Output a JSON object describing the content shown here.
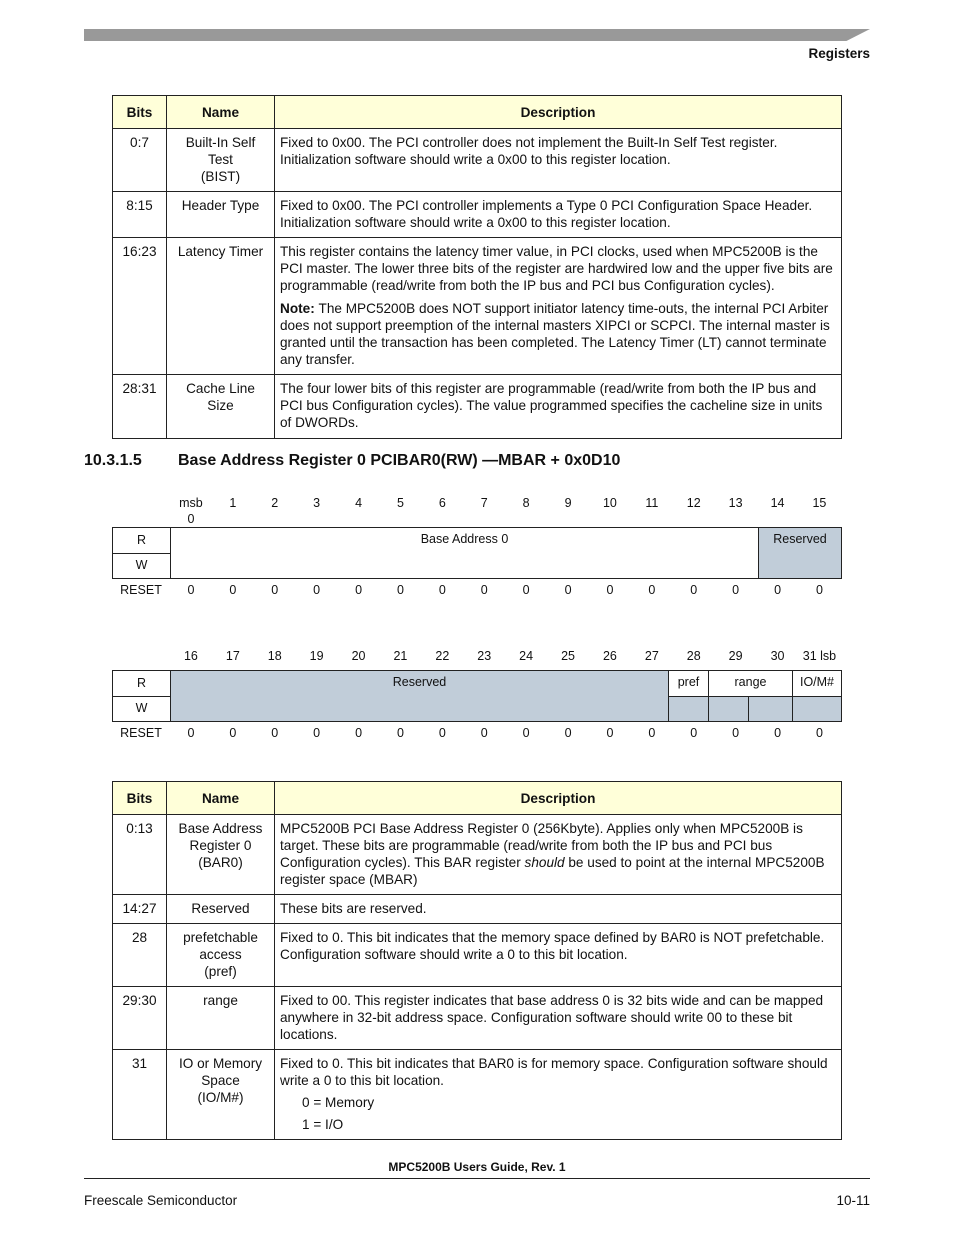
{
  "header": {
    "running_head": "Registers"
  },
  "table1": {
    "headers": [
      "Bits",
      "Name",
      "Description"
    ],
    "rows": [
      {
        "bits": "0:7",
        "name": [
          "Built-In Self",
          "Test",
          "(BIST)"
        ],
        "desc": "Fixed to 0x00. The PCI controller does not implement the Built-In Self Test register. Initialization software should write a 0x00 to this register location."
      },
      {
        "bits": "8:15",
        "name": [
          "Header Type"
        ],
        "desc": "Fixed to 0x00. The PCI controller implements a Type 0 PCI Configuration Space Header. Initialization software should write a 0x00 to this register location."
      },
      {
        "bits": "16:23",
        "name": [
          "Latency Timer"
        ],
        "desc": "This register contains the latency timer value, in PCI clocks, used when MPC5200B is the PCI master. The lower three bits of the register are hardwired low and the upper five bits are programmable (read/write from both the IP bus and PCI bus Configuration cycles).",
        "note_label": "Note:",
        "note": "The MPC5200B does NOT support initiator latency time-outs, the internal PCI Arbiter does not support preemption of the internal masters XIPCI or SCPCI. The internal master is granted until the transaction has been completed. The Latency Timer (LT) cannot terminate any transfer."
      },
      {
        "bits": "28:31",
        "name": [
          "Cache Line",
          "Size"
        ],
        "desc": "The four lower bits of this register are programmable (read/write from both the IP bus and PCI bus Configuration cycles). The value programmed specifies the cacheline size in units of DWORDs."
      }
    ]
  },
  "section": {
    "number": "10.3.1.5",
    "title": "Base Address Register 0 PCIBAR0(RW) —MBAR + 0x0D10"
  },
  "register_upper": {
    "bit_labels": [
      "msb\n0",
      "1",
      "2",
      "3",
      "4",
      "5",
      "6",
      "7",
      "8",
      "9",
      "10",
      "11",
      "12",
      "13",
      "14",
      "15"
    ],
    "r_label": "R",
    "w_label": "W",
    "reset_label": "RESET",
    "fields": [
      {
        "label": "Base Address 0"
      },
      {
        "label": "Reserved"
      }
    ],
    "reset": [
      "0",
      "0",
      "0",
      "0",
      "0",
      "0",
      "0",
      "0",
      "0",
      "0",
      "0",
      "0",
      "0",
      "0",
      "0",
      "0"
    ]
  },
  "register_lower": {
    "bit_labels": [
      "16",
      "17",
      "18",
      "19",
      "20",
      "21",
      "22",
      "23",
      "24",
      "25",
      "26",
      "27",
      "28",
      "29",
      "30",
      "31 lsb"
    ],
    "r_label": "R",
    "w_label": "W",
    "reset_label": "RESET",
    "fields": [
      {
        "label": "Reserved"
      },
      {
        "label": "pref"
      },
      {
        "label": "range"
      },
      {
        "label": "IO/M#"
      }
    ],
    "reset": [
      "0",
      "0",
      "0",
      "0",
      "0",
      "0",
      "0",
      "0",
      "0",
      "0",
      "0",
      "0",
      "0",
      "0",
      "0",
      "0"
    ]
  },
  "table2": {
    "headers": [
      "Bits",
      "Name",
      "Description"
    ],
    "rows": [
      {
        "bits": "0:13",
        "name": [
          "Base Address",
          "Register 0",
          "(BAR0)"
        ],
        "desc_pre": "MPC5200B PCI Base Address Register 0 (256Kbyte). Applies only when MPC5200B is target. These bits are programmable (read/write from both the IP bus and PCI bus Configuration cycles). This BAR register ",
        "desc_em": "should",
        "desc_post": " be used to point at the internal MPC5200B register space (MBAR)"
      },
      {
        "bits": "14:27",
        "name": [
          "Reserved"
        ],
        "desc": "These bits are reserved."
      },
      {
        "bits": "28",
        "name": [
          "prefetchable",
          "access",
          "(pref)"
        ],
        "desc": "Fixed to 0. This bit indicates that the memory space defined by BAR0 is NOT prefetchable. Configuration software should write a 0 to this bit location."
      },
      {
        "bits": "29:30",
        "name": [
          "range"
        ],
        "desc": "Fixed to 00. This register indicates that base address 0 is 32 bits wide and can be mapped anywhere in 32-bit address space. Configuration software should write 00 to these bit locations."
      },
      {
        "bits": "31",
        "name": [
          "IO or Memory",
          "Space",
          "(IO/M#)"
        ],
        "desc": "Fixed to 0. This bit indicates that BAR0 is for memory space. Configuration software should write a 0 to this bit location.",
        "enum": [
          "0 = Memory",
          "1 = I/O"
        ]
      }
    ]
  },
  "footer": {
    "title": "MPC5200B Users Guide, Rev. 1",
    "company": "Freescale Semiconductor",
    "page": "10-11"
  }
}
